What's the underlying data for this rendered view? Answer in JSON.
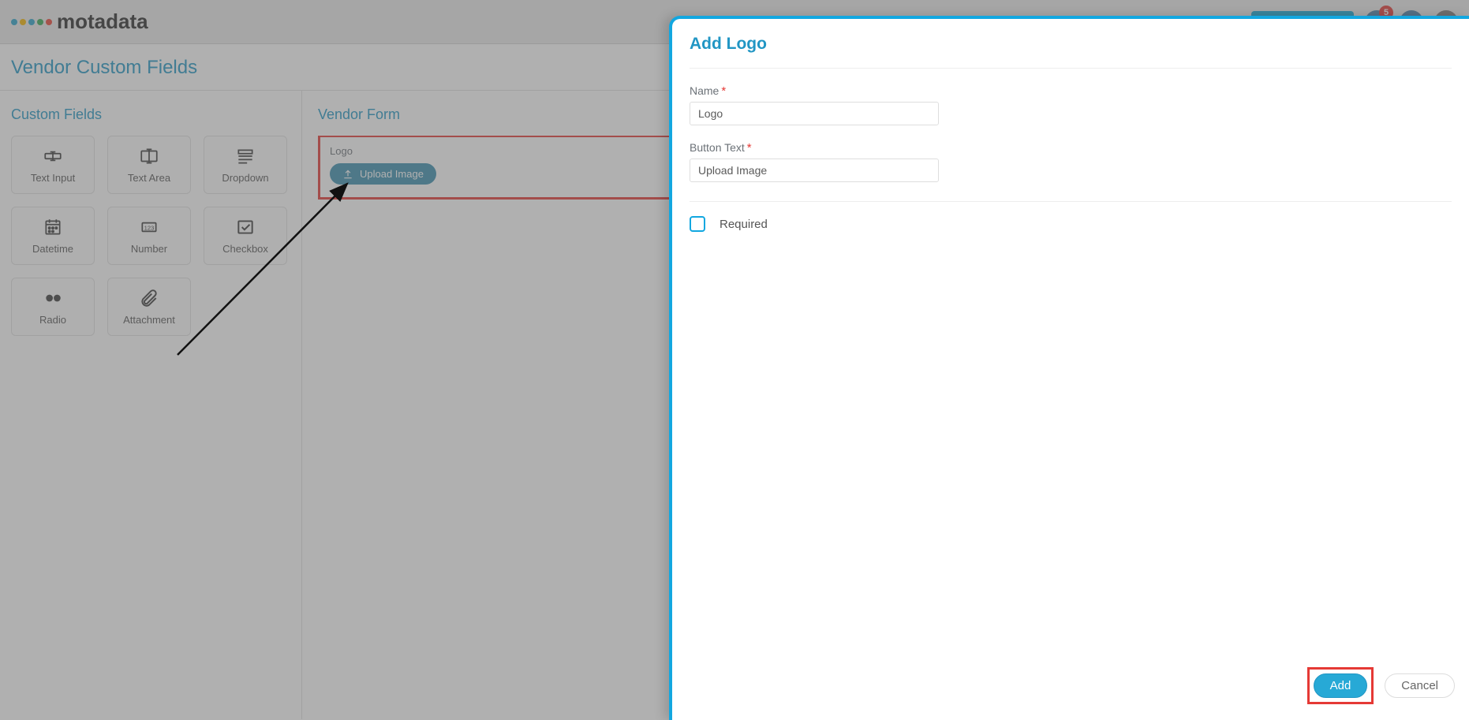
{
  "header": {
    "logo_text": "motadata",
    "badge_count": "5"
  },
  "page": {
    "title": "Vendor Custom Fields"
  },
  "custom_fields_panel": {
    "heading": "Custom Fields",
    "tiles": [
      {
        "label": "Text Input",
        "name": "text-input"
      },
      {
        "label": "Text Area",
        "name": "text-area"
      },
      {
        "label": "Dropdown",
        "name": "dropdown"
      },
      {
        "label": "Datetime",
        "name": "datetime"
      },
      {
        "label": "Number",
        "name": "number"
      },
      {
        "label": "Checkbox",
        "name": "checkbox"
      },
      {
        "label": "Radio",
        "name": "radio"
      },
      {
        "label": "Attachment",
        "name": "attachment"
      }
    ]
  },
  "vendor_form": {
    "heading": "Vendor Form",
    "field_label": "Logo",
    "upload_button": "Upload Image"
  },
  "drawer": {
    "title": "Add Logo",
    "name_label": "Name",
    "name_value": "Logo",
    "btn_text_label": "Button Text",
    "btn_text_value": "Upload Image",
    "required_label": "Required",
    "add_btn": "Add",
    "cancel_btn": "Cancel"
  }
}
